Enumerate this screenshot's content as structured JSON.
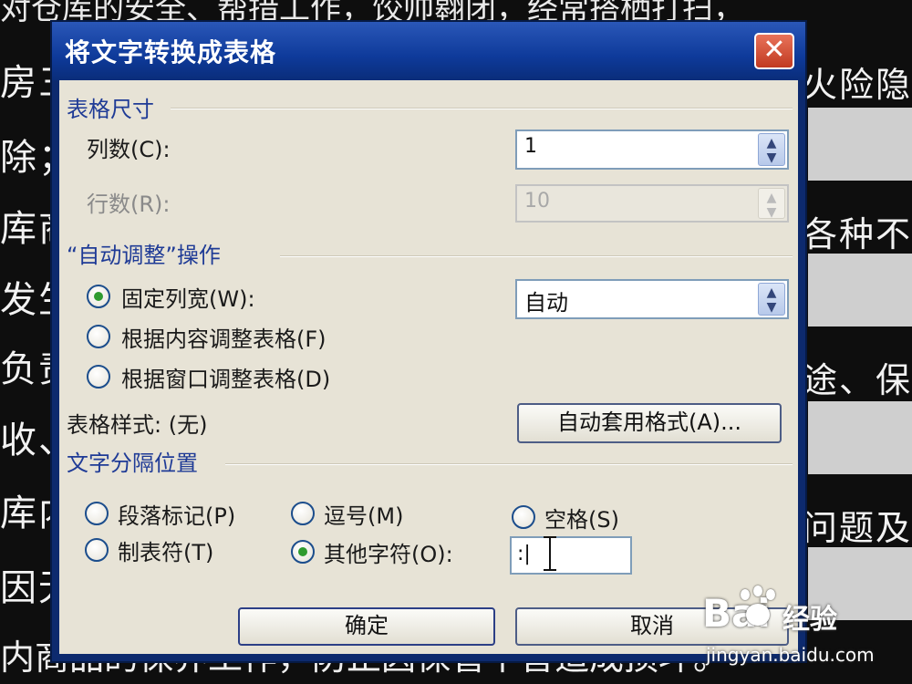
{
  "background_doc": {
    "top_text": "对仓库的安全、帮措工作，饺帅翱闭，经常搭栖打扫，",
    "left_lines": [
      "房三",
      "除；",
      "库商",
      "发生",
      "负责",
      "收、",
      "库内",
      "因无"
    ],
    "bottom_text": "内商品的保养工作，防止因保管不善造成损坏。",
    "right_lines": [
      "火险隐患",
      "各种不利",
      "途、保质",
      "问题及时"
    ]
  },
  "dialog": {
    "title": "将文字转换成表格",
    "close_label": "✕",
    "table_size": {
      "group_title": "表格尺寸",
      "columns_label": "列数(C):",
      "columns_value": "1",
      "rows_label": "行数(R):",
      "rows_value": "10"
    },
    "autofit": {
      "group_title": "“自动调整”操作",
      "options": [
        "固定列宽(W):",
        "根据内容调整表格(F)",
        "根据窗口调整表格(D)"
      ],
      "selected_index": 0,
      "fixed_width_value": "自动"
    },
    "table_style": {
      "label": "表格样式: (无)",
      "autoformat_button": "自动套用格式(A)..."
    },
    "separator": {
      "group_title": "文字分隔位置",
      "options": [
        "段落标记(P)",
        "逗号(M)",
        "空格(S)",
        "制表符(T)",
        "其他字符(O):"
      ],
      "selected_index": 4,
      "other_value": ":|"
    },
    "ok_button": "确定",
    "cancel_button": "取消"
  },
  "watermark": {
    "logo": "Bai",
    "logo_suffix": "经验",
    "url": "jingyan.baidu.com"
  }
}
